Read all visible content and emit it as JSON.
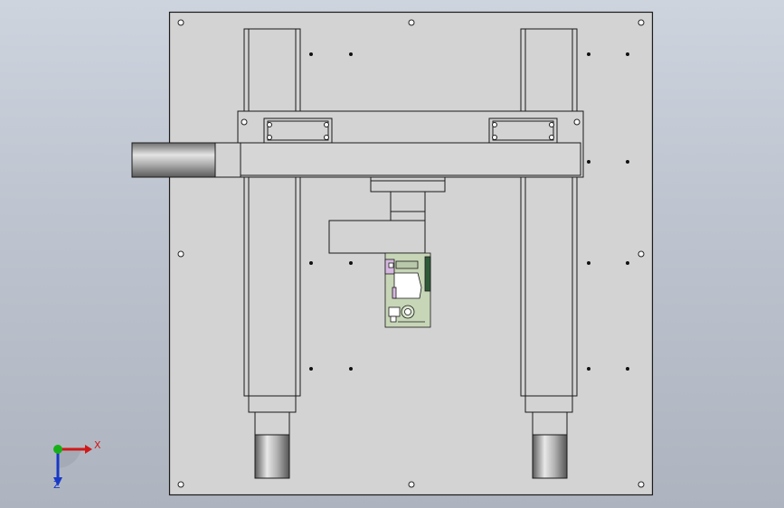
{
  "viewport": {
    "background_top": "#ced4de",
    "background_bottom": "#aeb4bf"
  },
  "model": {
    "plate_color": "#d3d3d3",
    "edge_color": "#1a1a1a",
    "cylinder_shade": "#8f8f8f",
    "clamp_colors": [
      "#c8d6b8",
      "#d6b8e0",
      "#ffffff",
      "#2f5a3a"
    ]
  },
  "triad": {
    "x_label": "X",
    "z_label": "Z",
    "x_color": "#d01818",
    "y_color": "#18b018",
    "z_color": "#1838c8"
  }
}
